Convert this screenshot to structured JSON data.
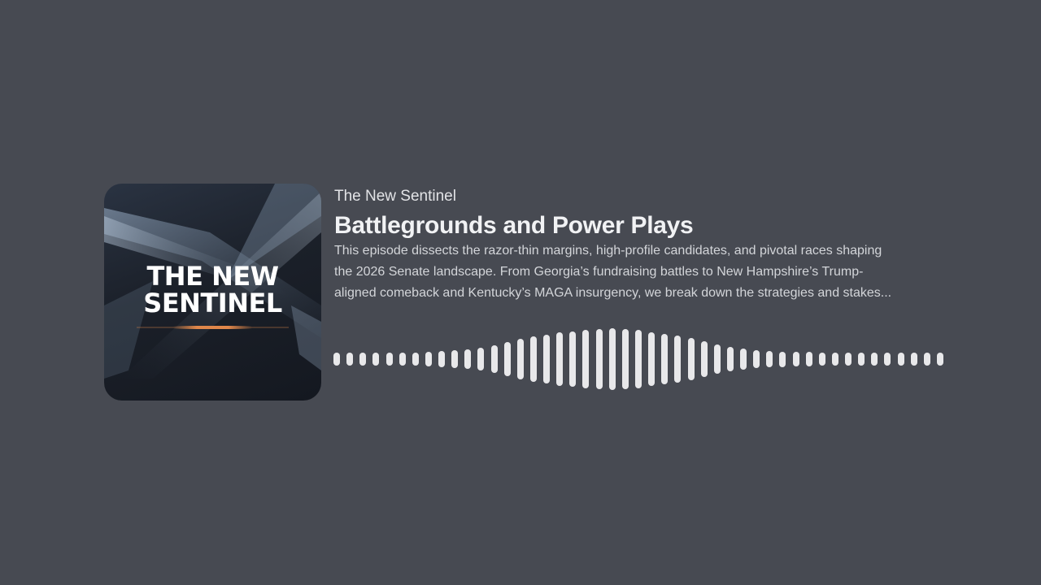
{
  "podcast": {
    "show_name": "The New Sentinel",
    "episode_title": "Battlegrounds and Power Plays",
    "description_lines": [
      "This episode dissects the razor-thin margins, high-profile candidates, and pivotal races shaping",
      "the 2026 Senate landscape. From Georgia’s fundraising battles to New Hampshire’s Trump-",
      "aligned comeback and Kentucky’s MAGA insurgency, we break down the strategies and stakes..."
    ]
  },
  "cover": {
    "title_line1": "THE NEW",
    "title_line2": "SENTINEL",
    "accent_color": "#e0874a"
  },
  "colors": {
    "background": "#474a52",
    "wave": "#e8e8ea"
  },
  "waveform": {
    "levels": [
      0.22,
      0.22,
      0.22,
      0.22,
      0.22,
      0.22,
      0.22,
      0.24,
      0.26,
      0.28,
      0.32,
      0.38,
      0.46,
      0.56,
      0.66,
      0.74,
      0.8,
      0.86,
      0.9,
      0.94,
      0.98,
      1.0,
      0.98,
      0.94,
      0.88,
      0.82,
      0.76,
      0.68,
      0.58,
      0.48,
      0.4,
      0.34,
      0.3,
      0.27,
      0.25,
      0.24,
      0.23,
      0.22,
      0.22,
      0.22,
      0.22,
      0.22,
      0.22,
      0.22,
      0.22,
      0.22,
      0.22
    ]
  }
}
